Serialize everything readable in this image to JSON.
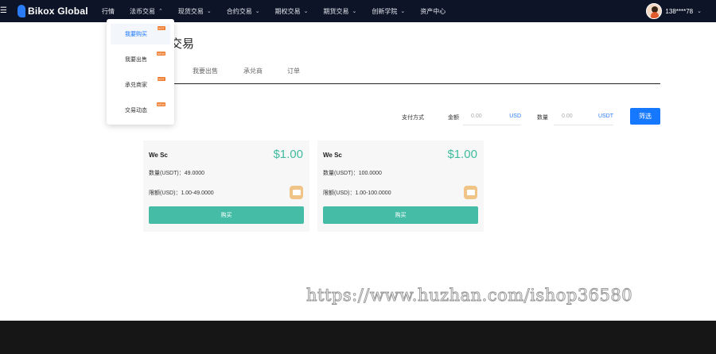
{
  "header": {
    "brand": "Bikox Global",
    "nav": [
      {
        "label": "行情",
        "chevron": false
      },
      {
        "label": "法币交易",
        "chevron": true
      },
      {
        "label": "现货交易",
        "chevron": true
      },
      {
        "label": "合约交易",
        "chevron": true
      },
      {
        "label": "期权交易",
        "chevron": true
      },
      {
        "label": "期货交易",
        "chevron": true
      },
      {
        "label": "创新学院",
        "chevron": true
      },
      {
        "label": "资产中心",
        "chevron": false
      }
    ],
    "user": "138****78"
  },
  "dropdown": {
    "items": [
      {
        "label": "我要购买",
        "badge": "HOT",
        "active": true
      },
      {
        "label": "我要出售",
        "badge": "NEW",
        "active": false
      },
      {
        "label": "承兑商家",
        "badge": "HOT",
        "active": false
      },
      {
        "label": "交易动态",
        "badge": "NEW",
        "active": false
      }
    ]
  },
  "page": {
    "title": "交易",
    "tabs": [
      "我要出售",
      "承兑商",
      "订单"
    ]
  },
  "filters": {
    "payment_label": "支付方式",
    "amount_label": "金额",
    "amount_placeholder": "0.00",
    "amount_unit": "USD",
    "quantity_label": "数量",
    "quantity_placeholder": "0.00",
    "quantity_unit": "USDT",
    "button": "筛选"
  },
  "offers": [
    {
      "merchant": "We Sc",
      "price": "$1.00",
      "quantity": "数量(USDT)：49.0000",
      "limit": "限额(USD)：1.00-49.0000",
      "buy": "购买"
    },
    {
      "merchant": "We Sc",
      "price": "$1.00",
      "quantity": "数量(USDT)：100.0000",
      "limit": "限额(USD)：1.00-100.0000",
      "buy": "购买"
    }
  ],
  "watermark": "https://www.huzhan.com/ishop36580",
  "colors": {
    "accent": "#1677ff",
    "price": "#3fbc9f",
    "buy_button": "#45bda6",
    "topbar": "#0d1428"
  }
}
